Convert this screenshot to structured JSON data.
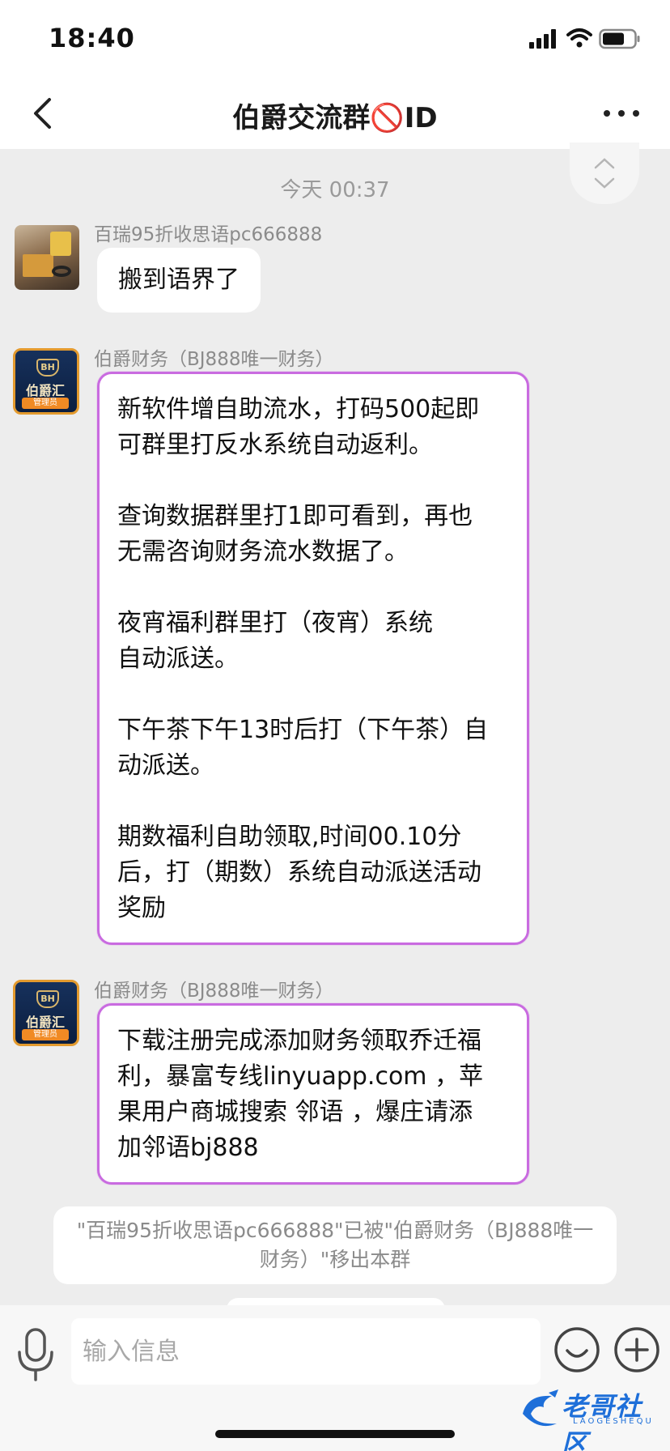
{
  "status_bar": {
    "time": "18:40"
  },
  "nav": {
    "title_prefix": "伯爵交流群",
    "title_icon": "🚫",
    "title_suffix": "ID"
  },
  "chat": {
    "timestamp": "今天 00:37",
    "messages": [
      {
        "sender": "百瑞95折收思语pc666888",
        "avatar": "photo-avatar",
        "text": "搬到语界了"
      },
      {
        "sender": "伯爵财务（BJ888唯一财务）",
        "avatar": "brand-avatar",
        "text": "新软件增自助流水，打码500起即\n可群里打反水系统自动返利。\n\n查询数据群里打1即可看到，再也\n无需咨询财务流水数据了。\n\n夜宵福利群里打（夜宵）系统\n自动派送。\n\n下午茶下午13时后打（下午茶）自\n动派送。\n\n期数福利自助领取,时间00.10分\n后，打（期数）系统自动派送活动\n奖励"
      },
      {
        "sender": "伯爵财务（BJ888唯一财务）",
        "avatar": "brand-avatar",
        "text": "下载注册完成添加财务领取乔迁福\n利，暴富专线linyuapp.com ，苹\n果用户商城搜索 邻语 ，爆庄请添\n加邻语bj888"
      }
    ],
    "system_notice": "\"百瑞95折收思语pc666888\"已被\"伯爵财务（BJ888唯一财务）\"移出本群"
  },
  "brand_avatar": {
    "crest": "BH",
    "name": "伯爵汇",
    "badge": "管理员"
  },
  "input": {
    "placeholder": "输入信息"
  },
  "watermark": {
    "text": "老哥社区",
    "sub": "LAOGESHEQU"
  },
  "colors": {
    "admin_bubble_border": "#c96be0",
    "background": "#ededed",
    "watermark": "#1e6fd9"
  }
}
